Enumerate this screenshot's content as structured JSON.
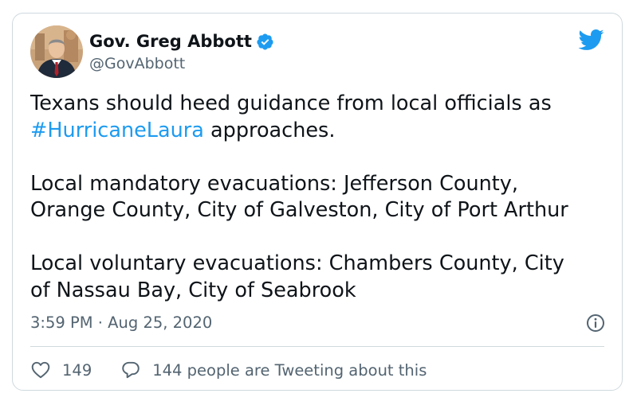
{
  "author": {
    "name": "Gov. Greg Abbott",
    "handle": "@GovAbbott",
    "verified": true,
    "avatar_icon": "profile-photo"
  },
  "tweet": {
    "intro_text": "Texans should heed guidance from local officials as",
    "hashtag": "#HurricaneLaura",
    "intro_tail": " approaches.",
    "mandatory_line1": "Local mandatory evacuations: Jefferson County,",
    "mandatory_line2": "Orange County, City of Galveston, City of Port Arthur",
    "voluntary_line1": "Local voluntary evacuations: Chambers County, City",
    "voluntary_line2": "of Nassau Bay, City of Seabrook"
  },
  "meta": {
    "timestamp": "3:59 PM · Aug 25, 2020"
  },
  "actions": {
    "like_count": "149",
    "reply_text": "144 people are Tweeting about this"
  },
  "icons": {
    "brand": "twitter-bird-icon",
    "verified": "verified-badge-icon",
    "info": "info-icon",
    "like": "heart-icon",
    "reply": "speech-bubble-icon"
  },
  "colors": {
    "accent": "#1d9bf0",
    "text": "#0f1419",
    "secondary": "#536471",
    "border": "#cfd9de"
  }
}
